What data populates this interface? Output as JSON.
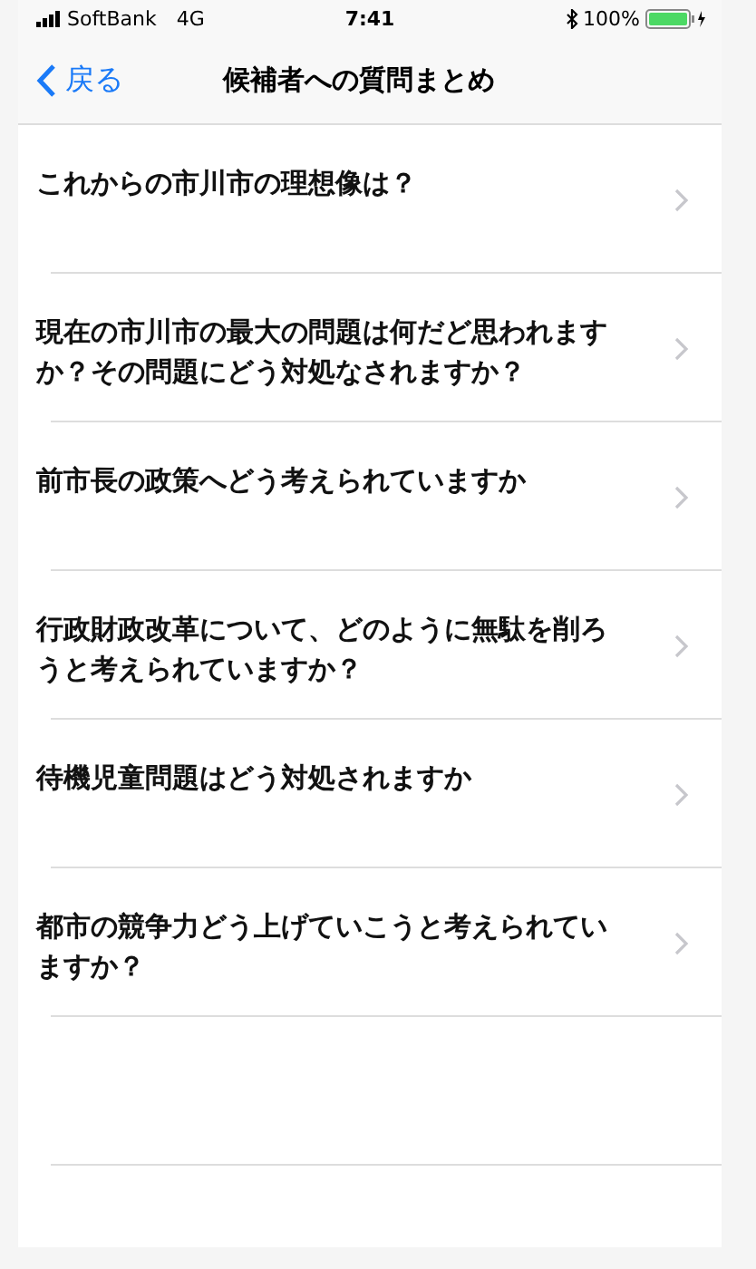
{
  "status_bar": {
    "carrier": "SoftBank",
    "network": "4G",
    "time": "7:41",
    "battery": "100%"
  },
  "nav": {
    "back": "戻る",
    "title": "候補者への質問まとめ"
  },
  "questions": [
    {
      "text": "これからの市川市の理想像は？"
    },
    {
      "text": "現在の市川市の最大の問題は何だど思われますか？その問題にどう対処なされますか？"
    },
    {
      "text": "前市長の政策へどう考えられていますか"
    },
    {
      "text": "行政財政改革について、どのように無駄を削ろうと考えられていますか？"
    },
    {
      "text": "待機児童問題はどう対処されますか"
    },
    {
      "text": "都市の競争力どう上げていこうと考えられていますか？"
    }
  ]
}
